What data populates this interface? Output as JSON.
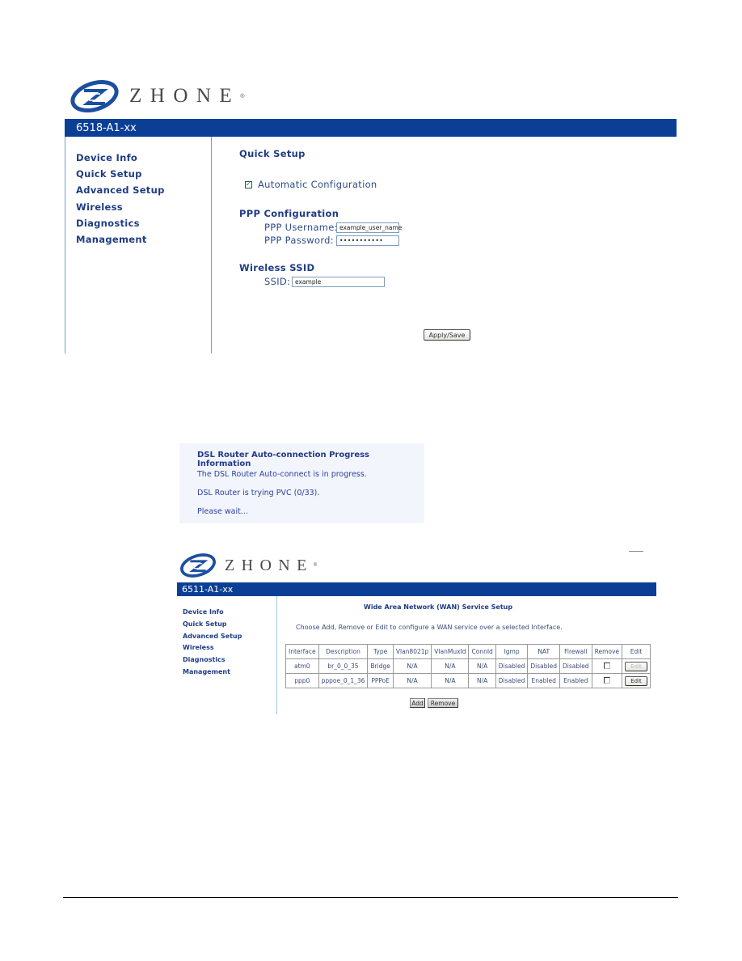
{
  "screen1": {
    "logo": {
      "text": "ZHONE",
      "registered": "®"
    },
    "model_bar": "6518-A1-xx",
    "sidebar": {
      "items": [
        {
          "label": "Device Info"
        },
        {
          "label": "Quick Setup"
        },
        {
          "label": "Advanced Setup"
        },
        {
          "label": "Wireless"
        },
        {
          "label": "Diagnostics"
        },
        {
          "label": "Management"
        }
      ]
    },
    "main": {
      "title": "Quick Setup",
      "auto_config": {
        "label": "Automatic Configuration",
        "checked": true,
        "check_glyph": "✓"
      },
      "ppp": {
        "heading": "PPP Configuration",
        "username_label": "PPP Username:",
        "username_value": "example_user_name",
        "password_label": "PPP Password:",
        "password_value": "•••••••••••"
      },
      "wireless": {
        "heading": "Wireless SSID",
        "ssid_label": "SSID:",
        "ssid_value": "example"
      },
      "apply_button": "Apply/Save"
    }
  },
  "progress_dialog": {
    "title": "DSL Router Auto-connection Progress Information",
    "lines": [
      "The DSL Router Auto-connect is in progress.",
      "DSL Router is trying PVC (0/33).",
      "Please wait..."
    ]
  },
  "screen2": {
    "logo": {
      "text": "ZHONE",
      "registered": "®"
    },
    "model_bar": "6511-A1-xx",
    "sidebar": {
      "items": [
        {
          "label": "Device Info"
        },
        {
          "label": "Quick Setup"
        },
        {
          "label": "Advanced Setup"
        },
        {
          "label": "Wireless"
        },
        {
          "label": "Diagnostics"
        },
        {
          "label": "Management"
        }
      ]
    },
    "main": {
      "title": "Wide Area Network (WAN) Service Setup",
      "description": "Choose Add, Remove or Edit to configure a WAN service over a selected Interface.",
      "table": {
        "headers": [
          "Interface",
          "Description",
          "Type",
          "Vlan8021p",
          "VlanMuxId",
          "ConnId",
          "Igmp",
          "NAT",
          "Firewall",
          "Remove",
          "Edit"
        ],
        "rows": [
          {
            "cells": [
              "atm0",
              "br_0_0_35",
              "Bridge",
              "N/A",
              "N/A",
              "N/A",
              "Disabled",
              "Disabled",
              "Disabled"
            ],
            "remove_checked": false,
            "edit_label": "Edit",
            "edit_enabled": false
          },
          {
            "cells": [
              "ppp0",
              "pppoe_0_1_36",
              "PPPoE",
              "N/A",
              "N/A",
              "N/A",
              "Disabled",
              "Enabled",
              "Enabled"
            ],
            "remove_checked": false,
            "edit_label": "Edit",
            "edit_enabled": true
          }
        ]
      },
      "add_button": "Add",
      "remove_button": "Remove"
    }
  },
  "colors": {
    "header_bar": "#0b3f96",
    "nav_text": "#1f3c84",
    "sidebar_border": "#6aa2cf",
    "logo_blue": "#1b4fa0"
  }
}
